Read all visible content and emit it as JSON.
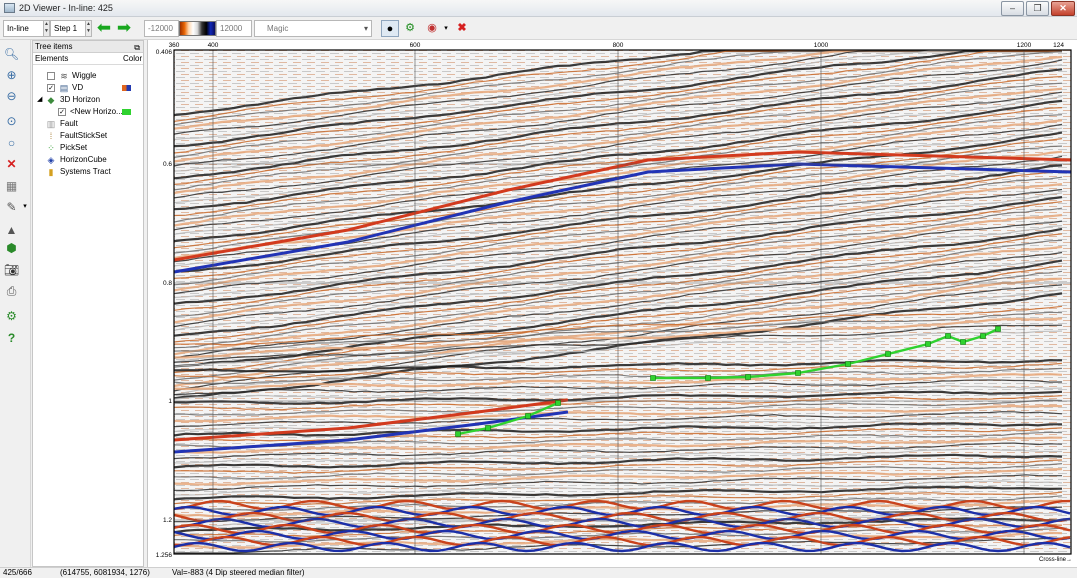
{
  "window": {
    "title": "2D Viewer - In-line: 425"
  },
  "toolbar": {
    "inline_value": "In-line 425",
    "step_value": "Step 1",
    "range_min": "-12000",
    "range_max": "12000",
    "colortable": "Magic",
    "colors": {
      "arrow": "#19a71f"
    }
  },
  "tree": {
    "header": "Tree items",
    "col_elements": "Elements",
    "col_color": "Color",
    "items": [
      {
        "label": "Wiggle",
        "checked": false
      },
      {
        "label": "VD",
        "checked": true
      },
      {
        "label": "3D Horizon"
      },
      {
        "label": "<New Horizo...",
        "checked": true,
        "color": "#2fd22f"
      },
      {
        "label": "Fault"
      },
      {
        "label": "FaultStickSet"
      },
      {
        "label": "PickSet"
      },
      {
        "label": "HorizonCube"
      },
      {
        "label": "Systems Tract"
      }
    ]
  },
  "plot": {
    "x_ticks": [
      "360",
      "400",
      "600",
      "800",
      "1000",
      "1200",
      "124"
    ],
    "y_ticks": [
      "0.406",
      "0.6",
      "0.8",
      "1",
      "1.2",
      "1.256"
    ],
    "crossline_label": "Cross-line→",
    "horizon_color": "#2fd22f"
  },
  "status": {
    "position": "425/666",
    "coords": "(614755, 6081934, 1276)",
    "value": "Val=-883 (4 Dip steered median filter)"
  }
}
